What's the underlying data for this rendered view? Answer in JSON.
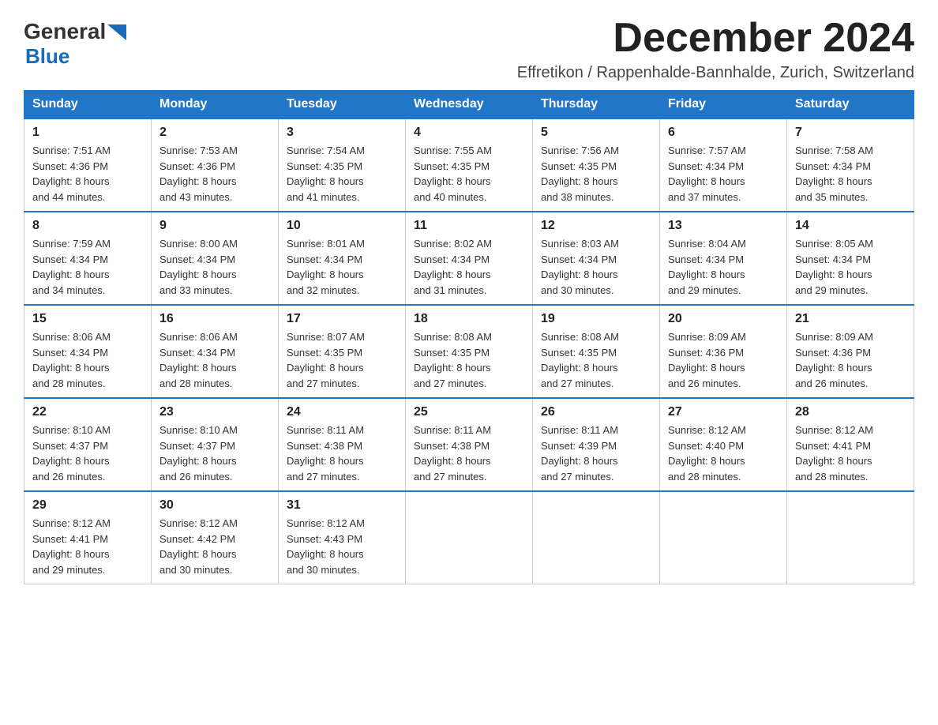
{
  "header": {
    "logo_general": "General",
    "logo_blue": "Blue",
    "month_title": "December 2024",
    "subtitle": "Effretikon / Rappenhalde-Bannhalde, Zurich, Switzerland"
  },
  "days_of_week": [
    "Sunday",
    "Monday",
    "Tuesday",
    "Wednesday",
    "Thursday",
    "Friday",
    "Saturday"
  ],
  "weeks": [
    [
      {
        "day": "1",
        "sunrise": "7:51 AM",
        "sunset": "4:36 PM",
        "daylight": "8 hours and 44 minutes."
      },
      {
        "day": "2",
        "sunrise": "7:53 AM",
        "sunset": "4:36 PM",
        "daylight": "8 hours and 43 minutes."
      },
      {
        "day": "3",
        "sunrise": "7:54 AM",
        "sunset": "4:35 PM",
        "daylight": "8 hours and 41 minutes."
      },
      {
        "day": "4",
        "sunrise": "7:55 AM",
        "sunset": "4:35 PM",
        "daylight": "8 hours and 40 minutes."
      },
      {
        "day": "5",
        "sunrise": "7:56 AM",
        "sunset": "4:35 PM",
        "daylight": "8 hours and 38 minutes."
      },
      {
        "day": "6",
        "sunrise": "7:57 AM",
        "sunset": "4:34 PM",
        "daylight": "8 hours and 37 minutes."
      },
      {
        "day": "7",
        "sunrise": "7:58 AM",
        "sunset": "4:34 PM",
        "daylight": "8 hours and 35 minutes."
      }
    ],
    [
      {
        "day": "8",
        "sunrise": "7:59 AM",
        "sunset": "4:34 PM",
        "daylight": "8 hours and 34 minutes."
      },
      {
        "day": "9",
        "sunrise": "8:00 AM",
        "sunset": "4:34 PM",
        "daylight": "8 hours and 33 minutes."
      },
      {
        "day": "10",
        "sunrise": "8:01 AM",
        "sunset": "4:34 PM",
        "daylight": "8 hours and 32 minutes."
      },
      {
        "day": "11",
        "sunrise": "8:02 AM",
        "sunset": "4:34 PM",
        "daylight": "8 hours and 31 minutes."
      },
      {
        "day": "12",
        "sunrise": "8:03 AM",
        "sunset": "4:34 PM",
        "daylight": "8 hours and 30 minutes."
      },
      {
        "day": "13",
        "sunrise": "8:04 AM",
        "sunset": "4:34 PM",
        "daylight": "8 hours and 29 minutes."
      },
      {
        "day": "14",
        "sunrise": "8:05 AM",
        "sunset": "4:34 PM",
        "daylight": "8 hours and 29 minutes."
      }
    ],
    [
      {
        "day": "15",
        "sunrise": "8:06 AM",
        "sunset": "4:34 PM",
        "daylight": "8 hours and 28 minutes."
      },
      {
        "day": "16",
        "sunrise": "8:06 AM",
        "sunset": "4:34 PM",
        "daylight": "8 hours and 28 minutes."
      },
      {
        "day": "17",
        "sunrise": "8:07 AM",
        "sunset": "4:35 PM",
        "daylight": "8 hours and 27 minutes."
      },
      {
        "day": "18",
        "sunrise": "8:08 AM",
        "sunset": "4:35 PM",
        "daylight": "8 hours and 27 minutes."
      },
      {
        "day": "19",
        "sunrise": "8:08 AM",
        "sunset": "4:35 PM",
        "daylight": "8 hours and 27 minutes."
      },
      {
        "day": "20",
        "sunrise": "8:09 AM",
        "sunset": "4:36 PM",
        "daylight": "8 hours and 26 minutes."
      },
      {
        "day": "21",
        "sunrise": "8:09 AM",
        "sunset": "4:36 PM",
        "daylight": "8 hours and 26 minutes."
      }
    ],
    [
      {
        "day": "22",
        "sunrise": "8:10 AM",
        "sunset": "4:37 PM",
        "daylight": "8 hours and 26 minutes."
      },
      {
        "day": "23",
        "sunrise": "8:10 AM",
        "sunset": "4:37 PM",
        "daylight": "8 hours and 26 minutes."
      },
      {
        "day": "24",
        "sunrise": "8:11 AM",
        "sunset": "4:38 PM",
        "daylight": "8 hours and 27 minutes."
      },
      {
        "day": "25",
        "sunrise": "8:11 AM",
        "sunset": "4:38 PM",
        "daylight": "8 hours and 27 minutes."
      },
      {
        "day": "26",
        "sunrise": "8:11 AM",
        "sunset": "4:39 PM",
        "daylight": "8 hours and 27 minutes."
      },
      {
        "day": "27",
        "sunrise": "8:12 AM",
        "sunset": "4:40 PM",
        "daylight": "8 hours and 28 minutes."
      },
      {
        "day": "28",
        "sunrise": "8:12 AM",
        "sunset": "4:41 PM",
        "daylight": "8 hours and 28 minutes."
      }
    ],
    [
      {
        "day": "29",
        "sunrise": "8:12 AM",
        "sunset": "4:41 PM",
        "daylight": "8 hours and 29 minutes."
      },
      {
        "day": "30",
        "sunrise": "8:12 AM",
        "sunset": "4:42 PM",
        "daylight": "8 hours and 30 minutes."
      },
      {
        "day": "31",
        "sunrise": "8:12 AM",
        "sunset": "4:43 PM",
        "daylight": "8 hours and 30 minutes."
      },
      null,
      null,
      null,
      null
    ]
  ],
  "labels": {
    "sunrise_prefix": "Sunrise: ",
    "sunset_prefix": "Sunset: ",
    "daylight_prefix": "Daylight: "
  }
}
